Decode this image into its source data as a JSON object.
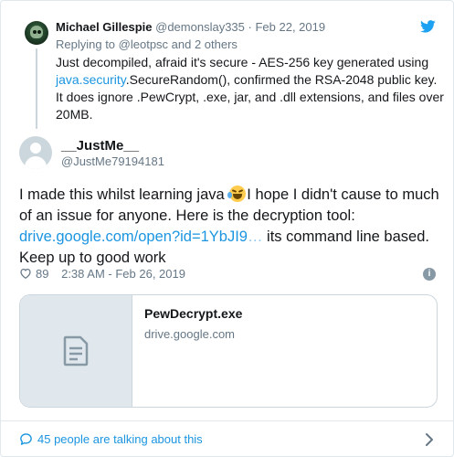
{
  "parent_tweet": {
    "name": "Michael Gillespie",
    "handle": "@demonslay335",
    "separator": "·",
    "date": "Feb 22, 2019",
    "reply_prefix": "Replying to ",
    "reply_to": "@leotpsc",
    "reply_suffix": " and 2 others",
    "text_1": "Just decompiled, afraid it's secure - AES-256 key generated using ",
    "text_link": "java.security",
    "text_2": ".SecureRandom(), confirmed the RSA-2048 public key. It does ignore .PewCrypt, .exe, jar, and .dll extensions, and files over 20MB."
  },
  "main_tweet": {
    "name": "__JustMe__",
    "handle": "@JustMe79194181",
    "text_1": "I made this whilst learning java ",
    "text_2": "I hope I didn't cause to much of an issue for anyone. Here is the decryption tool: ",
    "link_visible": "drive.google.com/open?id=1YbJI9",
    "link_ellipsis": "…",
    "text_3": " its command line based. Keep up to good work",
    "likes": "89",
    "timestamp": "2:38 AM - Feb 26, 2019",
    "info_glyph": "i"
  },
  "card": {
    "title": "PewDecrypt.exe",
    "domain": "drive.google.com"
  },
  "footer": {
    "talking": "45 people are talking about this"
  },
  "colors": {
    "link": "#1b95e0",
    "muted": "#657786",
    "text": "#14171a",
    "border": "#e1e8ed",
    "like_icon": "#657786"
  }
}
